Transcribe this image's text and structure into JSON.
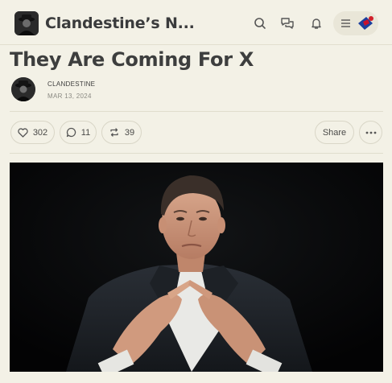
{
  "header": {
    "publication_name": "Clandestine’s N...",
    "icons": [
      "search-icon",
      "chat-icon",
      "bell-icon",
      "menu-icon",
      "flag-avatar-icon"
    ]
  },
  "post": {
    "title": "They Are Coming For X",
    "author": "CLANDESTINE",
    "date": "MAR 13, 2024"
  },
  "actions": {
    "likes": "302",
    "comments": "11",
    "restacks": "39",
    "share_label": "Share"
  },
  "colors": {
    "background": "#f3f1e6",
    "text": "#363737",
    "border": "#d9d6c7",
    "hero_background": "#050607"
  }
}
